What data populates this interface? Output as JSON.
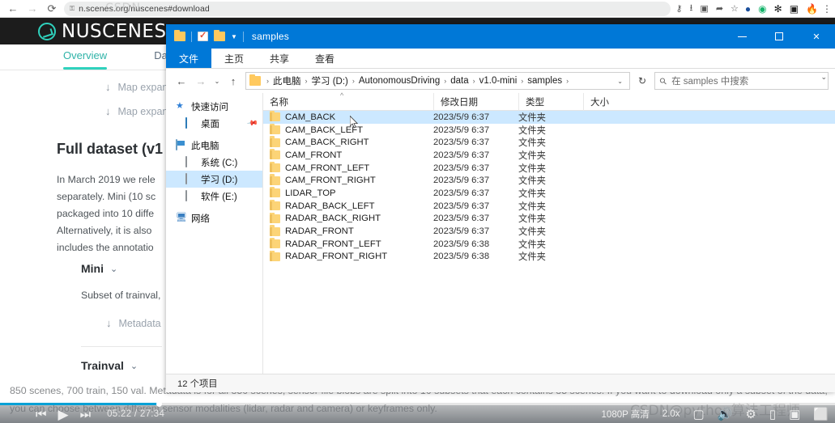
{
  "browser": {
    "back_icon": "←",
    "forward_icon": "→",
    "reload_icon": "⟳",
    "lock_icon": "🔒",
    "url": "n.scenes.org/nuscenes#download",
    "omni_icons": [
      "key-icon",
      "install-icon",
      "translate-icon",
      "share-icon",
      "bookmark-star-icon"
    ],
    "ext_icons": [
      "extension-blue-icon",
      "extension-green-icon",
      "puzzle-icon",
      "sidepanel-icon",
      "profile-flame-icon"
    ],
    "menu_icon": "⋮",
    "ghost_watermark": "CSDN"
  },
  "nuscenes": {
    "logo_text": "NUSCENES",
    "tabs": [
      {
        "label": "Overview",
        "active": true
      },
      {
        "label": "Data",
        "active": false
      }
    ],
    "download_links": [
      {
        "label": "Map expansion p",
        "icon": "download-icon"
      },
      {
        "label": "Map expansion p",
        "icon": "download-icon"
      }
    ],
    "full_dataset_title": "Full dataset (v1",
    "paragraph_lines": [
      "In March 2019 we rele",
      "separately. Mini (10 sc",
      "packaged into 10 diffe",
      "Alternatively, it is also",
      "includes the annotatio"
    ],
    "sections": [
      {
        "title": "Mini",
        "chevron": "⌄",
        "subtitle": "Subset of trainval,",
        "download": {
          "label": "Metadata",
          "icon": "download-icon"
        }
      },
      {
        "title": "Trainval",
        "chevron": "⌄",
        "subtitle": "",
        "download": null
      }
    ],
    "bottom_paragraph": "850 scenes, 700 train, 150 val. Metadata is for all 850 scenes, sensor file blobs are split into 10 subsets that each contains 85 scenes. If you want to download only a subset of the data, you can choose between different sensor modalities (lidar, radar and camera) or keyframes only."
  },
  "pip_button": {
    "icon": "picture-in-picture-icon"
  },
  "watermarks": {
    "csdn": "CSDN@python算法工程师",
    "tv_icon": "bilibili-tv-play-icon"
  },
  "player": {
    "prev_icon": "⏮",
    "play_icon": "▶",
    "next_icon": "⏭",
    "time": "05:22 / 27:34",
    "quality": "1080P 高清",
    "speed": "2.0x",
    "right_icons": [
      "danmaku-icon",
      "volume-icon",
      "settings-icon",
      "widescreen-icon",
      "webfullscreen-icon",
      "fullscreen-icon"
    ],
    "progress_percent": 19
  },
  "explorer": {
    "title": "samples",
    "quick_access_icons": [
      "folder-icon",
      "properties-checkbox-icon",
      "new-folder-icon",
      "customize-dropdown-icon"
    ],
    "window_controls": {
      "minimize": "minimize-icon",
      "maximize": "maximize-icon",
      "close": "close-icon"
    },
    "ribbon": {
      "file_tab": "文件",
      "tabs": [
        "主页",
        "共享",
        "查看"
      ],
      "expand_icon": "⌄"
    },
    "address": {
      "back_icon": "←",
      "forward_icon": "→",
      "recent_icon": "⌄",
      "up_icon": "↑",
      "breadcrumbs": [
        "此电脑",
        "学习 (D:)",
        "AutonomousDriving",
        "data",
        "v1.0-mini",
        "samples"
      ],
      "dropdown_icon": "⌄",
      "refresh_icon": "↻"
    },
    "search": {
      "icon": "search-icon",
      "placeholder": "在 samples 中搜索"
    },
    "sidebar": [
      {
        "label": "快速访问",
        "icon": "star-icon",
        "indent": 0,
        "selected": false,
        "pinned": false
      },
      {
        "label": "桌面",
        "icon": "desktop-icon",
        "indent": 1,
        "selected": false,
        "pinned": true
      },
      {
        "label": "此电脑",
        "icon": "this-pc-icon",
        "indent": 0,
        "selected": false,
        "pinned": false
      },
      {
        "label": "系统 (C:)",
        "icon": "drive-system-icon",
        "indent": 1,
        "selected": false,
        "pinned": false
      },
      {
        "label": "学习 (D:)",
        "icon": "drive-icon",
        "indent": 1,
        "selected": true,
        "pinned": false
      },
      {
        "label": "软件 (E:)",
        "icon": "drive-icon",
        "indent": 1,
        "selected": false,
        "pinned": false
      },
      {
        "label": "网络",
        "icon": "network-icon",
        "indent": 0,
        "selected": false,
        "pinned": false
      }
    ],
    "columns": [
      {
        "label": "名称",
        "sorted": true,
        "sort_icon": "^"
      },
      {
        "label": "修改日期",
        "sorted": false
      },
      {
        "label": "类型",
        "sorted": false
      },
      {
        "label": "大小",
        "sorted": false
      }
    ],
    "files": [
      {
        "name": "CAM_BACK",
        "date": "2023/5/9 6:37",
        "type": "文件夹",
        "size": "",
        "selected": true
      },
      {
        "name": "CAM_BACK_LEFT",
        "date": "2023/5/9 6:37",
        "type": "文件夹",
        "size": "",
        "selected": false
      },
      {
        "name": "CAM_BACK_RIGHT",
        "date": "2023/5/9 6:37",
        "type": "文件夹",
        "size": "",
        "selected": false
      },
      {
        "name": "CAM_FRONT",
        "date": "2023/5/9 6:37",
        "type": "文件夹",
        "size": "",
        "selected": false
      },
      {
        "name": "CAM_FRONT_LEFT",
        "date": "2023/5/9 6:37",
        "type": "文件夹",
        "size": "",
        "selected": false
      },
      {
        "name": "CAM_FRONT_RIGHT",
        "date": "2023/5/9 6:37",
        "type": "文件夹",
        "size": "",
        "selected": false
      },
      {
        "name": "LIDAR_TOP",
        "date": "2023/5/9 6:37",
        "type": "文件夹",
        "size": "",
        "selected": false
      },
      {
        "name": "RADAR_BACK_LEFT",
        "date": "2023/5/9 6:37",
        "type": "文件夹",
        "size": "",
        "selected": false
      },
      {
        "name": "RADAR_BACK_RIGHT",
        "date": "2023/5/9 6:37",
        "type": "文件夹",
        "size": "",
        "selected": false
      },
      {
        "name": "RADAR_FRONT",
        "date": "2023/5/9 6:37",
        "type": "文件夹",
        "size": "",
        "selected": false
      },
      {
        "name": "RADAR_FRONT_LEFT",
        "date": "2023/5/9 6:38",
        "type": "文件夹",
        "size": "",
        "selected": false
      },
      {
        "name": "RADAR_FRONT_RIGHT",
        "date": "2023/5/9 6:38",
        "type": "文件夹",
        "size": "",
        "selected": false
      }
    ],
    "status": "12 个项目"
  },
  "colors": {
    "explorer_accent": "#0078d7",
    "selection": "#cce8ff",
    "nuscenes_teal": "#2fd2bd",
    "progress": "#00a1d6",
    "folder": "#fcd477"
  }
}
